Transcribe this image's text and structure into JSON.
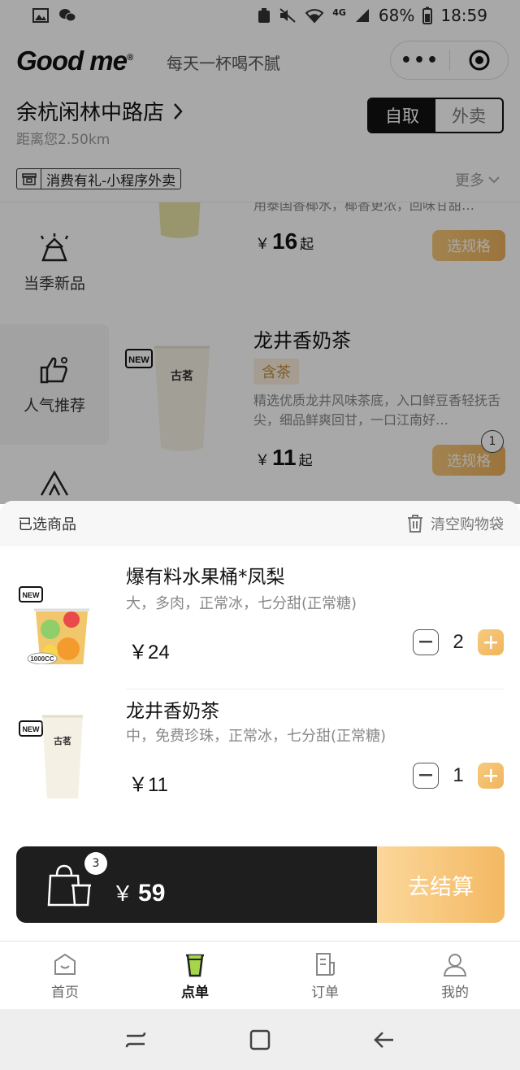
{
  "status_bar": {
    "network": "4G",
    "battery": "68%",
    "time": "18:59"
  },
  "header": {
    "logo": "Good me",
    "logo_mark": "®",
    "slogan": "每天一杯喝不腻",
    "capsule_more": "•••"
  },
  "store": {
    "name": "余杭闲林中路店",
    "distance": "距离您2.50km"
  },
  "order_mode": {
    "pickup": "自取",
    "delivery": "外卖",
    "active": "pickup"
  },
  "promo": {
    "text": "消费有礼-小程序外卖",
    "more": "更多"
  },
  "categories": [
    {
      "label": "当季新品",
      "icon": "new-season-icon"
    },
    {
      "label": "人气推荐",
      "icon": "thumbs-up-icon"
    }
  ],
  "products": [
    {
      "name": "",
      "desc": "用泰国香椰水，椰香更浓，回味甘甜…",
      "price_symbol": "￥",
      "price": "16",
      "price_suffix": "起",
      "button": "选规格"
    },
    {
      "name": "龙井香奶茶",
      "badge": "NEW",
      "cup_brand": "古茗",
      "tag": "含茶",
      "desc": "精选优质龙井风味茶底，入口鲜豆香轻抚舌尖，细品鲜爽回甘，一口江南好…",
      "price_symbol": "￥",
      "price": "11",
      "price_suffix": "起",
      "button": "选规格",
      "cart_count": "1"
    }
  ],
  "cart": {
    "title": "已选商品",
    "clear_label": "清空购物袋",
    "items": [
      {
        "name": "爆有料水果桶*凤梨",
        "options": "大，多肉，正常冰，七分甜(正常糖)",
        "price": "￥24",
        "qty": "2",
        "badge": "NEW",
        "cup_label": "1000CC"
      },
      {
        "name": "龙井香奶茶",
        "options": "中，免费珍珠，正常冰，七分甜(正常糖)",
        "price": "￥11",
        "qty": "1",
        "badge": "NEW",
        "cup_brand": "古茗"
      }
    ]
  },
  "checkout": {
    "count": "3",
    "currency": "￥",
    "total": "59",
    "button": "去结算"
  },
  "tabbar": [
    {
      "label": "首页",
      "icon": "home-icon"
    },
    {
      "label": "点单",
      "icon": "cup-icon",
      "active": true
    },
    {
      "label": "订单",
      "icon": "order-icon"
    },
    {
      "label": "我的",
      "icon": "profile-icon"
    }
  ],
  "colors": {
    "accent_gold": "#f0b45d",
    "dark": "#1e1e1e",
    "tag_text": "#c08a3e"
  }
}
